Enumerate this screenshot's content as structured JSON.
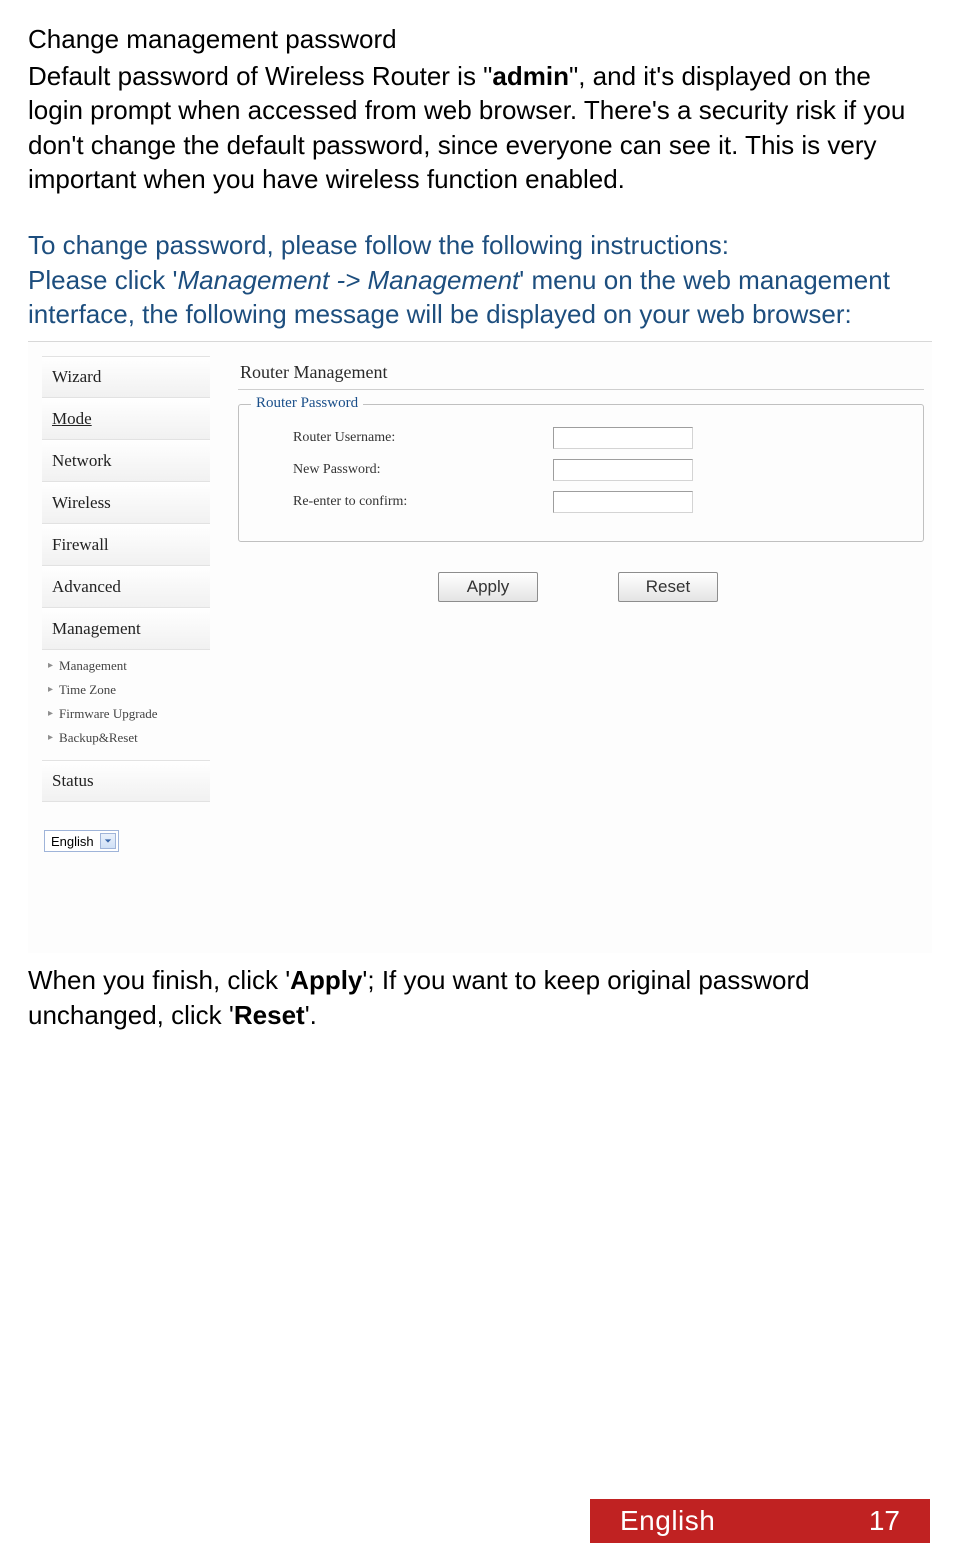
{
  "section_title": "Change management password",
  "intro": {
    "pre": "Default password of Wireless Router is \"",
    "admin": "admin",
    "post": "\", and it's displayed on the login prompt when accessed from web browser. There's a security risk if you don't change the default password, since everyone can see it. This is very important when you have wireless function enabled."
  },
  "blue_para": {
    "l1": "To change password, please  follow the following instructions:",
    "l2_pre": "Please click '",
    "l2_path": "Management -> Management",
    "l2_post": "' menu on the web management interface, the following message will be displayed on your web browser:"
  },
  "screenshot": {
    "sidebar": {
      "items": [
        {
          "label": "Wizard"
        },
        {
          "label": "Mode"
        },
        {
          "label": "Network"
        },
        {
          "label": "Wireless"
        },
        {
          "label": "Firewall"
        },
        {
          "label": "Advanced"
        },
        {
          "label": "Management"
        }
      ],
      "sub_items": [
        {
          "label": "Management"
        },
        {
          "label": "Time Zone"
        },
        {
          "label": "Firmware Upgrade"
        },
        {
          "label": "Backup&Reset"
        }
      ],
      "status": "Status",
      "lang": "English"
    },
    "panel": {
      "title": "Router Management",
      "legend": "Router Password",
      "rows": [
        {
          "label": "Router Username:"
        },
        {
          "label": "New Password:"
        },
        {
          "label": "Re-enter to confirm:"
        }
      ],
      "apply": "Apply",
      "reset": "Reset"
    }
  },
  "closing": {
    "p1": "When you finish, click '",
    "apply": "Apply",
    "p2": "'; If you want to keep original password unchanged, click '",
    "reset": "Reset",
    "p3": "'."
  },
  "footer": {
    "lang": "English",
    "page": "17"
  }
}
